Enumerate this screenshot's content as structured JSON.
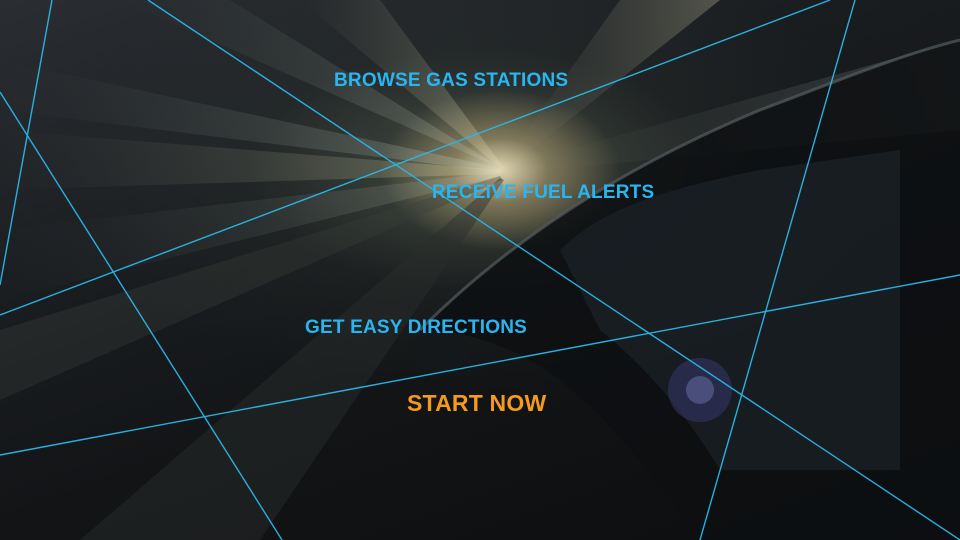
{
  "menu": {
    "browse_label": "BROWSE GAS STATIONS",
    "alerts_label": "RECEIVE FUEL ALERTS",
    "directions_label": "GET EASY DIRECTIONS"
  },
  "cta": {
    "start_label": "START NOW"
  },
  "colors": {
    "menu_text": "#29b6f0",
    "cta_text": "#f49a1c",
    "line": "#2ab8e8"
  },
  "background": {
    "description_icon": "speeding-car-light-streaks"
  }
}
